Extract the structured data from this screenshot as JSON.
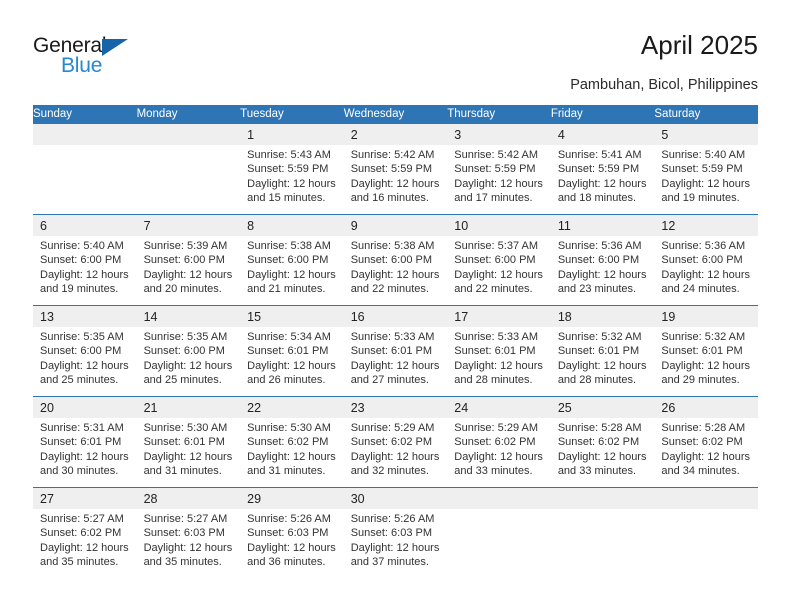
{
  "brand": {
    "name_part1": "General",
    "name_part2": "Blue",
    "accent_color": "#2389d6",
    "triangle_color": "#1565a8"
  },
  "header": {
    "title": "April 2025",
    "location": "Pambuhan, Bicol, Philippines"
  },
  "theme": {
    "header_blue": "#2e75b6",
    "daynum_band": "#efefef",
    "cell_text": "#333333"
  },
  "weekdays": [
    "Sunday",
    "Monday",
    "Tuesday",
    "Wednesday",
    "Thursday",
    "Friday",
    "Saturday"
  ],
  "weeks": [
    [
      {
        "day": "",
        "lines": []
      },
      {
        "day": "",
        "lines": []
      },
      {
        "day": "1",
        "lines": [
          "Sunrise: 5:43 AM",
          "Sunset: 5:59 PM",
          "Daylight: 12 hours",
          "and 15 minutes."
        ]
      },
      {
        "day": "2",
        "lines": [
          "Sunrise: 5:42 AM",
          "Sunset: 5:59 PM",
          "Daylight: 12 hours",
          "and 16 minutes."
        ]
      },
      {
        "day": "3",
        "lines": [
          "Sunrise: 5:42 AM",
          "Sunset: 5:59 PM",
          "Daylight: 12 hours",
          "and 17 minutes."
        ]
      },
      {
        "day": "4",
        "lines": [
          "Sunrise: 5:41 AM",
          "Sunset: 5:59 PM",
          "Daylight: 12 hours",
          "and 18 minutes."
        ]
      },
      {
        "day": "5",
        "lines": [
          "Sunrise: 5:40 AM",
          "Sunset: 5:59 PM",
          "Daylight: 12 hours",
          "and 19 minutes."
        ]
      }
    ],
    [
      {
        "day": "6",
        "lines": [
          "Sunrise: 5:40 AM",
          "Sunset: 6:00 PM",
          "Daylight: 12 hours",
          "and 19 minutes."
        ]
      },
      {
        "day": "7",
        "lines": [
          "Sunrise: 5:39 AM",
          "Sunset: 6:00 PM",
          "Daylight: 12 hours",
          "and 20 minutes."
        ]
      },
      {
        "day": "8",
        "lines": [
          "Sunrise: 5:38 AM",
          "Sunset: 6:00 PM",
          "Daylight: 12 hours",
          "and 21 minutes."
        ]
      },
      {
        "day": "9",
        "lines": [
          "Sunrise: 5:38 AM",
          "Sunset: 6:00 PM",
          "Daylight: 12 hours",
          "and 22 minutes."
        ]
      },
      {
        "day": "10",
        "lines": [
          "Sunrise: 5:37 AM",
          "Sunset: 6:00 PM",
          "Daylight: 12 hours",
          "and 22 minutes."
        ]
      },
      {
        "day": "11",
        "lines": [
          "Sunrise: 5:36 AM",
          "Sunset: 6:00 PM",
          "Daylight: 12 hours",
          "and 23 minutes."
        ]
      },
      {
        "day": "12",
        "lines": [
          "Sunrise: 5:36 AM",
          "Sunset: 6:00 PM",
          "Daylight: 12 hours",
          "and 24 minutes."
        ]
      }
    ],
    [
      {
        "day": "13",
        "lines": [
          "Sunrise: 5:35 AM",
          "Sunset: 6:00 PM",
          "Daylight: 12 hours",
          "and 25 minutes."
        ]
      },
      {
        "day": "14",
        "lines": [
          "Sunrise: 5:35 AM",
          "Sunset: 6:00 PM",
          "Daylight: 12 hours",
          "and 25 minutes."
        ]
      },
      {
        "day": "15",
        "lines": [
          "Sunrise: 5:34 AM",
          "Sunset: 6:01 PM",
          "Daylight: 12 hours",
          "and 26 minutes."
        ]
      },
      {
        "day": "16",
        "lines": [
          "Sunrise: 5:33 AM",
          "Sunset: 6:01 PM",
          "Daylight: 12 hours",
          "and 27 minutes."
        ]
      },
      {
        "day": "17",
        "lines": [
          "Sunrise: 5:33 AM",
          "Sunset: 6:01 PM",
          "Daylight: 12 hours",
          "and 28 minutes."
        ]
      },
      {
        "day": "18",
        "lines": [
          "Sunrise: 5:32 AM",
          "Sunset: 6:01 PM",
          "Daylight: 12 hours",
          "and 28 minutes."
        ]
      },
      {
        "day": "19",
        "lines": [
          "Sunrise: 5:32 AM",
          "Sunset: 6:01 PM",
          "Daylight: 12 hours",
          "and 29 minutes."
        ]
      }
    ],
    [
      {
        "day": "20",
        "lines": [
          "Sunrise: 5:31 AM",
          "Sunset: 6:01 PM",
          "Daylight: 12 hours",
          "and 30 minutes."
        ]
      },
      {
        "day": "21",
        "lines": [
          "Sunrise: 5:30 AM",
          "Sunset: 6:01 PM",
          "Daylight: 12 hours",
          "and 31 minutes."
        ]
      },
      {
        "day": "22",
        "lines": [
          "Sunrise: 5:30 AM",
          "Sunset: 6:02 PM",
          "Daylight: 12 hours",
          "and 31 minutes."
        ]
      },
      {
        "day": "23",
        "lines": [
          "Sunrise: 5:29 AM",
          "Sunset: 6:02 PM",
          "Daylight: 12 hours",
          "and 32 minutes."
        ]
      },
      {
        "day": "24",
        "lines": [
          "Sunrise: 5:29 AM",
          "Sunset: 6:02 PM",
          "Daylight: 12 hours",
          "and 33 minutes."
        ]
      },
      {
        "day": "25",
        "lines": [
          "Sunrise: 5:28 AM",
          "Sunset: 6:02 PM",
          "Daylight: 12 hours",
          "and 33 minutes."
        ]
      },
      {
        "day": "26",
        "lines": [
          "Sunrise: 5:28 AM",
          "Sunset: 6:02 PM",
          "Daylight: 12 hours",
          "and 34 minutes."
        ]
      }
    ],
    [
      {
        "day": "27",
        "lines": [
          "Sunrise: 5:27 AM",
          "Sunset: 6:02 PM",
          "Daylight: 12 hours",
          "and 35 minutes."
        ]
      },
      {
        "day": "28",
        "lines": [
          "Sunrise: 5:27 AM",
          "Sunset: 6:03 PM",
          "Daylight: 12 hours",
          "and 35 minutes."
        ]
      },
      {
        "day": "29",
        "lines": [
          "Sunrise: 5:26 AM",
          "Sunset: 6:03 PM",
          "Daylight: 12 hours",
          "and 36 minutes."
        ]
      },
      {
        "day": "30",
        "lines": [
          "Sunrise: 5:26 AM",
          "Sunset: 6:03 PM",
          "Daylight: 12 hours",
          "and 37 minutes."
        ]
      },
      {
        "day": "",
        "lines": []
      },
      {
        "day": "",
        "lines": []
      },
      {
        "day": "",
        "lines": []
      }
    ]
  ]
}
